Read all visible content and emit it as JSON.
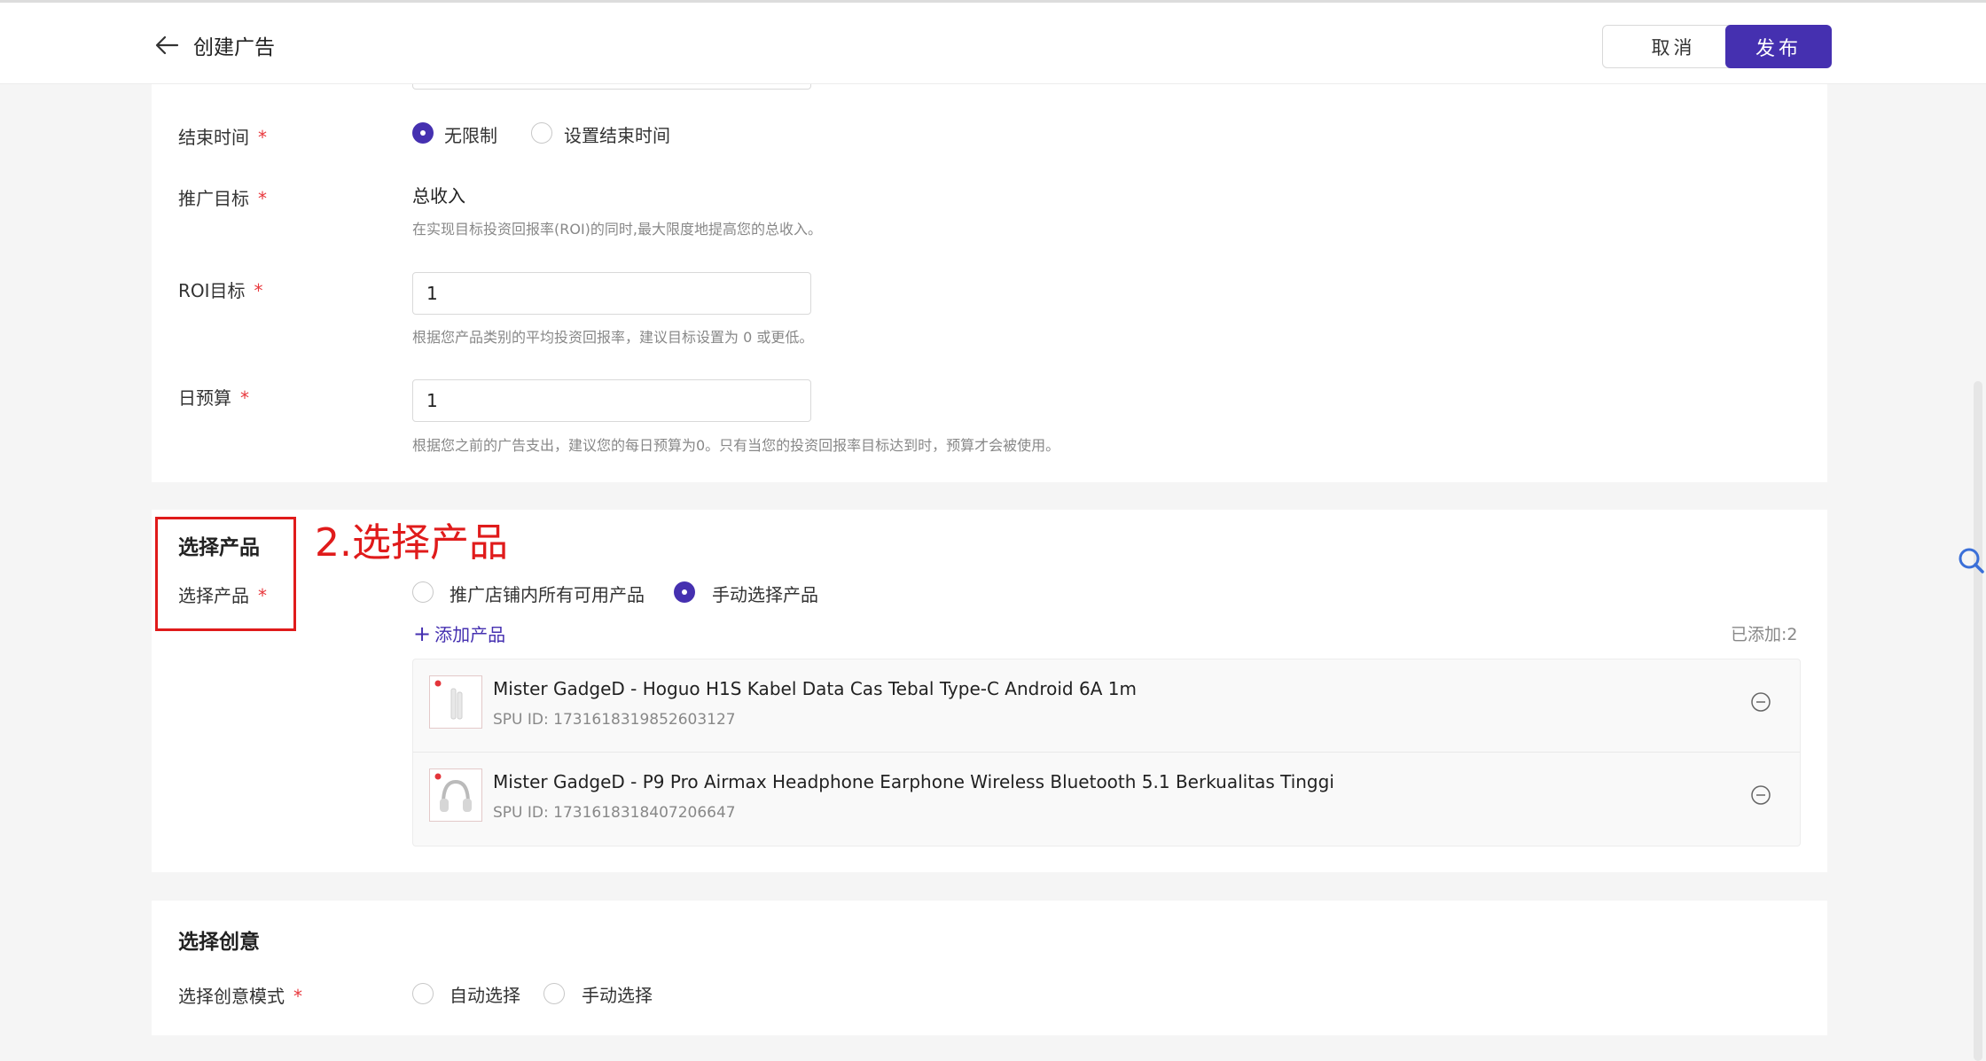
{
  "header": {
    "title": "创建广告",
    "cancel_label": "取消",
    "publish_label": "发布"
  },
  "settings": {
    "end_time": {
      "label": "结束时间",
      "options": [
        "无限制",
        "设置结束时间"
      ],
      "selected": "无限制"
    },
    "goal": {
      "label": "推广目标",
      "value": "总收入",
      "hint": "在实现目标投资回报率(ROI)的同时,最大限度地提高您的总收入。"
    },
    "roi": {
      "label": "ROI目标",
      "value": "1",
      "hint": "根据您产品类别的平均投资回报率，建议目标设置为 0 或更低。"
    },
    "budget": {
      "label": "日预算",
      "value": "1",
      "hint": "根据您之前的广告支出，建议您的每日预算为0。只有当您的投资回报率目标达到时，预算才会被使用。"
    },
    "required_mark": "*"
  },
  "products": {
    "section_title": "选择产品",
    "label": "选择产品",
    "options": [
      "推广店铺内所有可用产品",
      "手动选择产品"
    ],
    "selected": "手动选择产品",
    "add_label": "添加产品",
    "added_count": "已添加:2",
    "annotation": "2.选择产品",
    "items": [
      {
        "name": "Mister GadgeD - Hoguo H1S Kabel Data Cas Tebal Type-C Android 6A 1m",
        "spu": "SPU ID: 1731618319852603127"
      },
      {
        "name": "Mister GadgeD - P9 Pro Airmax Headphone Earphone Wireless Bluetooth 5.1 Berkualitas Tinggi",
        "spu": "SPU ID: 1731618318407206647"
      }
    ]
  },
  "creative": {
    "section_title": "选择创意",
    "label": "选择创意模式",
    "options": [
      "自动选择",
      "手动选择"
    ]
  },
  "colors": {
    "accent": "#4530b0",
    "required": "#e8383d",
    "annotation": "#e01b1b"
  },
  "icons": {
    "back": "arrow-left-icon",
    "remove": "minus-circle-icon",
    "add": "plus-icon",
    "search": "search-icon"
  }
}
